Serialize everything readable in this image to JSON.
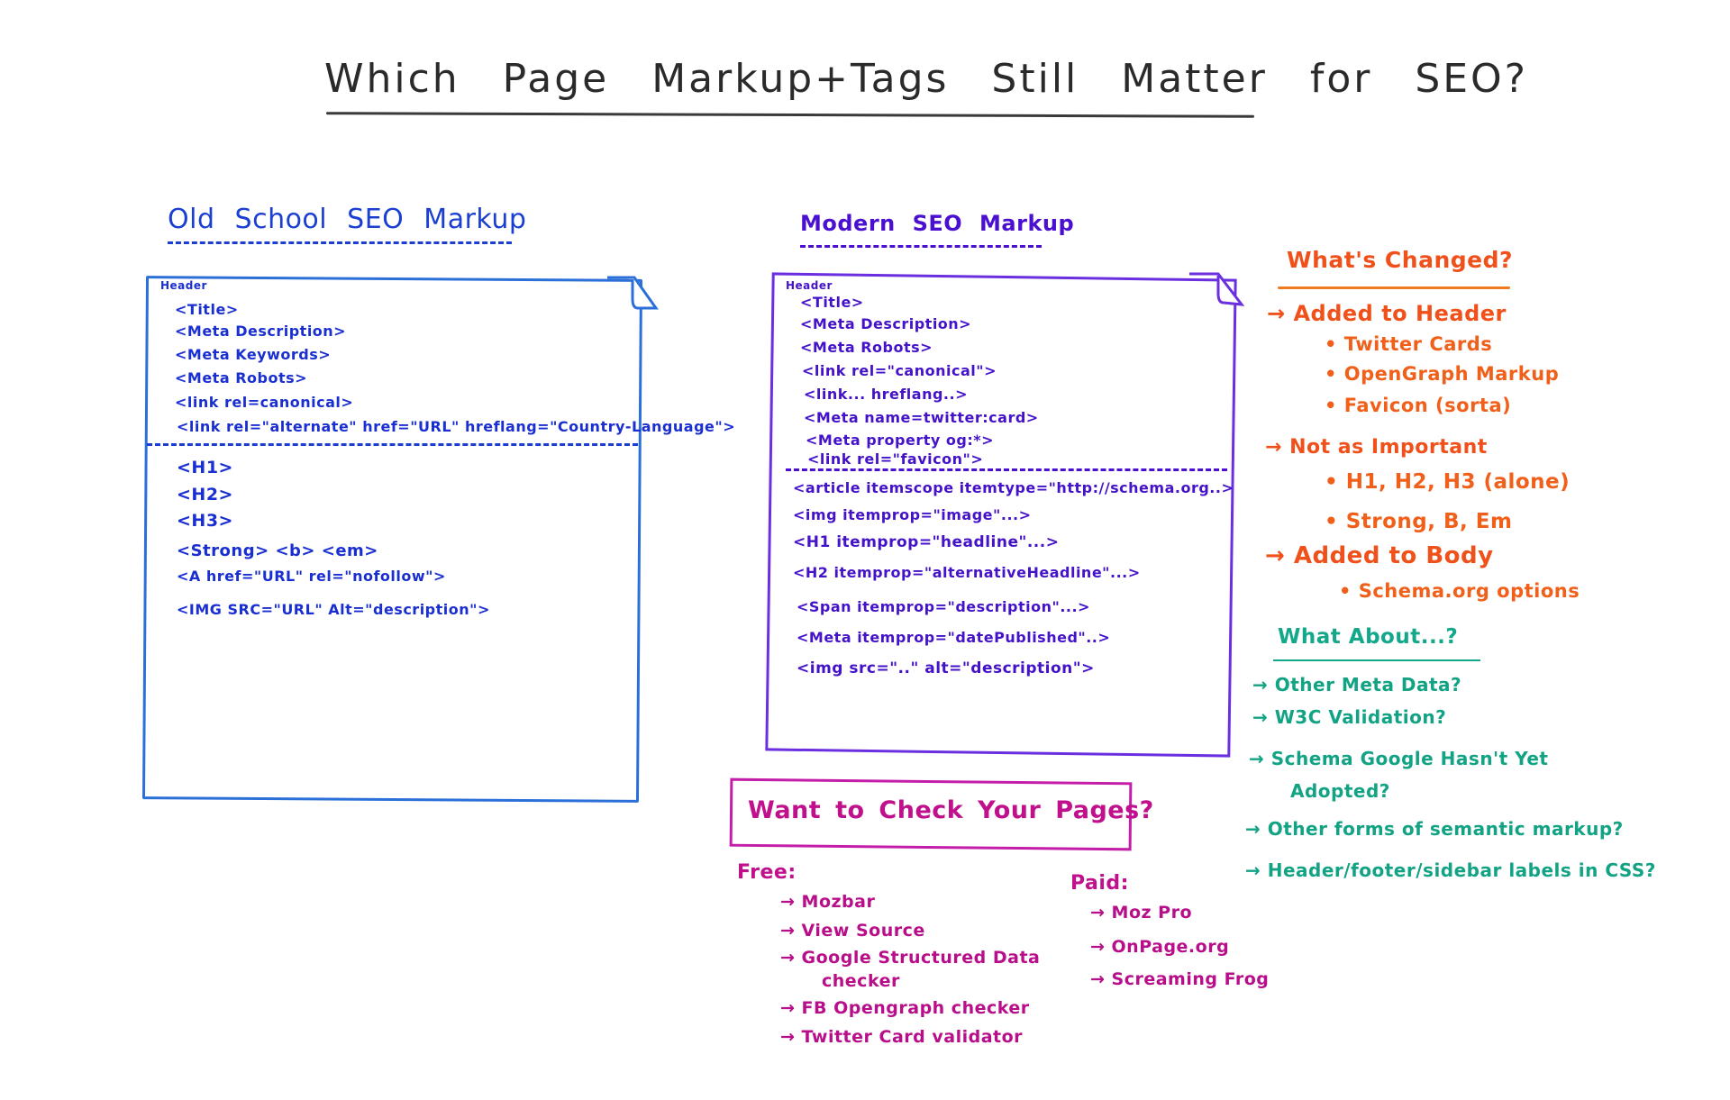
{
  "title": "Which Page Markup+Tags Still Matter for SEO?",
  "old_school": {
    "heading": "Old School SEO Markup",
    "header_label": "Header",
    "header_tags": [
      "<Title>",
      "<Meta Description>",
      "<Meta Keywords>",
      "<Meta Robots>",
      "<link rel=canonical>",
      "<link rel=\"alternate\" href=\"URL\" hreflang=\"Country-Language\">"
    ],
    "body_tags": [
      "<H1>",
      "<H2>",
      "<H3>",
      "<Strong> <b> <em>",
      "<A href=\"URL\" rel=\"nofollow\">",
      "<IMG SRC=\"URL\" Alt=\"description\">"
    ]
  },
  "modern": {
    "heading": "Modern SEO Markup",
    "header_label": "Header",
    "header_tags": [
      "<Title>",
      "<Meta Description>",
      "<Meta Robots>",
      "<link rel=\"canonical\">",
      "<link... hreflang..>",
      "<Meta name=twitter:card>",
      "<Meta property og:*>",
      "<link rel=\"favicon\">"
    ],
    "body_tags": [
      "<article itemscope itemtype=\"http://schema.org..>",
      "<img itemprop=\"image\"...>",
      "<H1 itemprop=\"headline\"...>",
      "<H2 itemprop=\"alternativeHeadline\"...>",
      "<Span itemprop=\"description\"...>",
      "<Meta itemprop=\"datePublished\"..>",
      "<img src=\"..\" alt=\"description\">"
    ]
  },
  "whats_changed": {
    "heading": "What's Changed?",
    "groups": [
      {
        "label": "→ Added to Header",
        "items": [
          "• Twitter Cards",
          "• OpenGraph Markup",
          "• Favicon (sorta)"
        ]
      },
      {
        "label": "→ Not as Important",
        "items": [
          "• H1, H2, H3 (alone)",
          "• Strong, B, Em"
        ]
      },
      {
        "label": "→ Added to Body",
        "items": [
          "• Schema.org options"
        ]
      }
    ]
  },
  "what_about": {
    "heading": "What About...?",
    "items": [
      "→ Other Meta Data?",
      "→ W3C Validation?",
      "→ Schema Google Hasn't Yet",
      "Adopted?",
      "→ Other forms of semantic markup?",
      "→ Header/footer/sidebar labels in CSS?"
    ]
  },
  "check_pages": {
    "heading": "Want to Check Your Pages?",
    "free_label": "Free:",
    "free_items": [
      "→ Mozbar",
      "→ View Source",
      "→ Google Structured Data",
      "checker",
      "→ FB Opengraph checker",
      "→ Twitter Card validator"
    ],
    "paid_label": "Paid:",
    "paid_items": [
      "→ Moz Pro",
      "→ OnPage.org",
      "→ Screaming Frog"
    ]
  },
  "colors": {
    "title": "#2a2a2a",
    "old_school": "#1a3fd1",
    "modern": "#4a0fd0",
    "changed": "#f0501a",
    "about": "#14a88a",
    "check": "#c0108c"
  }
}
